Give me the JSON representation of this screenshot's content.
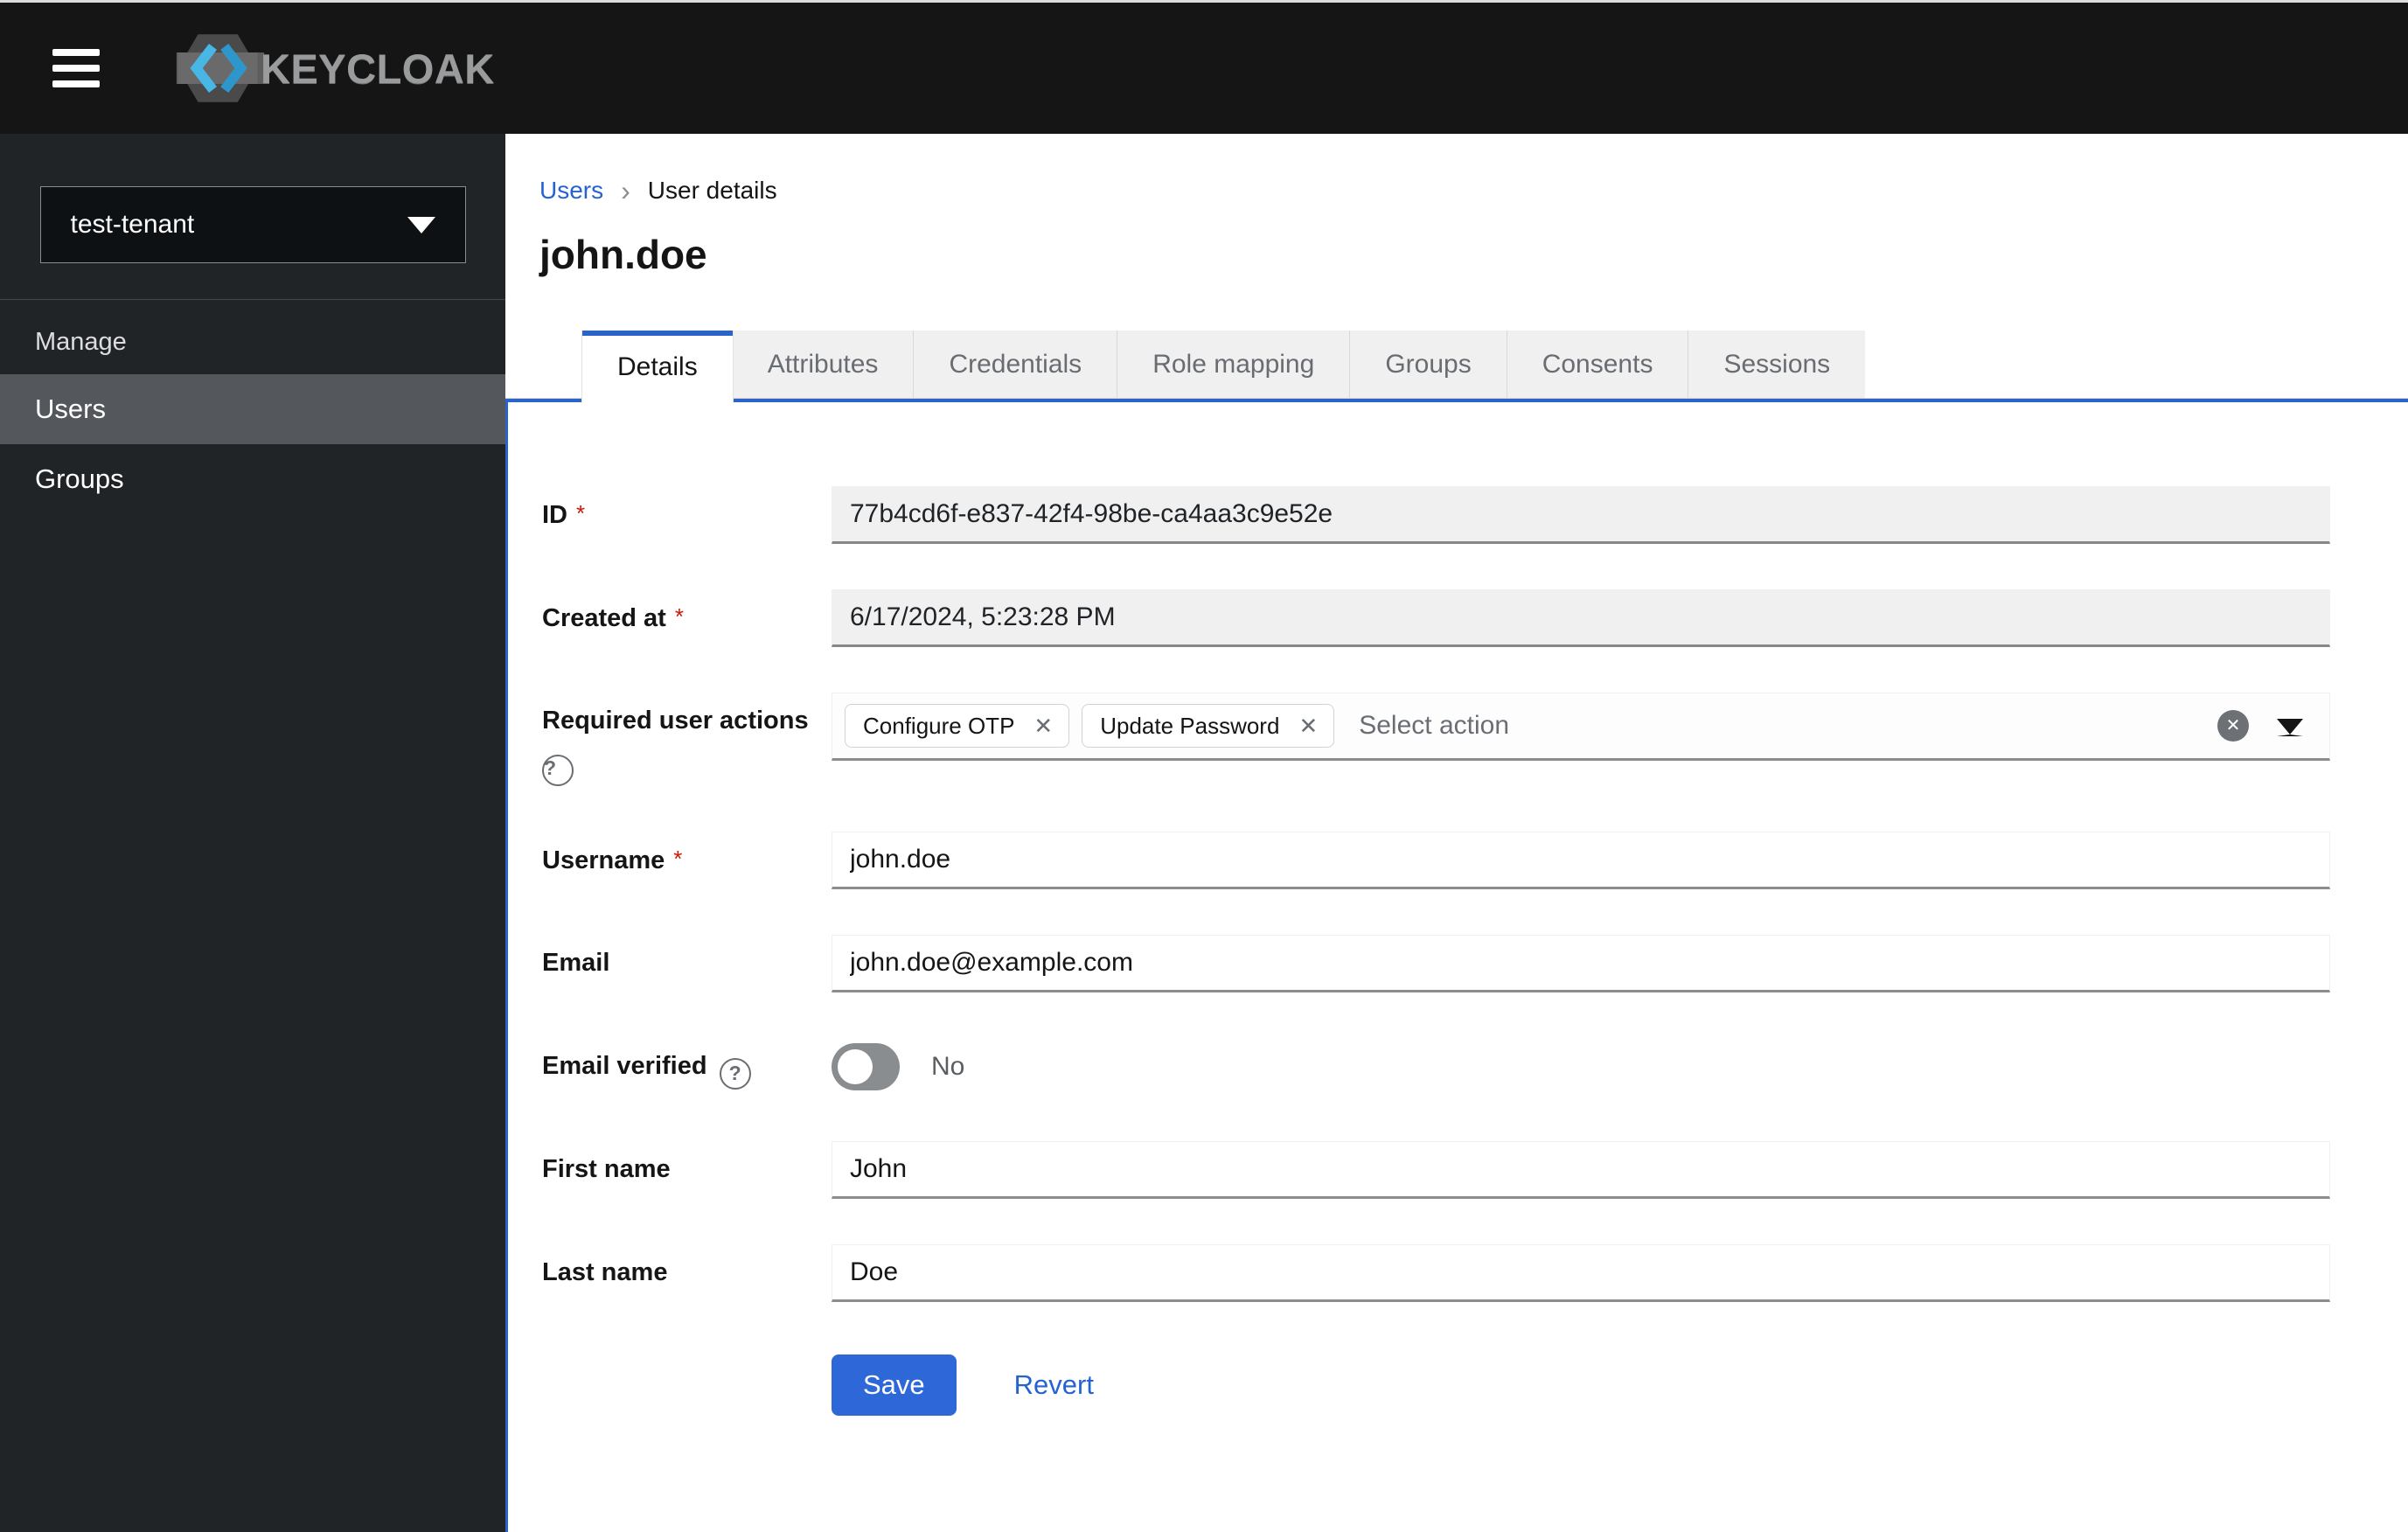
{
  "masthead": {
    "brand": "KEYCLOAK"
  },
  "sidebar": {
    "realm_selector": {
      "value": "test-tenant"
    },
    "section_label": "Manage",
    "items": [
      {
        "label": "Users",
        "selected": true
      },
      {
        "label": "Groups",
        "selected": false
      }
    ]
  },
  "breadcrumb": {
    "items": [
      {
        "label": "Users",
        "link": true
      },
      {
        "label": "User details",
        "link": false
      }
    ]
  },
  "page": {
    "title": "john.doe"
  },
  "tabs": [
    "Details",
    "Attributes",
    "Credentials",
    "Role mapping",
    "Groups",
    "Consents",
    "Sessions"
  ],
  "active_tab": "Details",
  "form": {
    "id": {
      "label": "ID",
      "required": true,
      "value": "77b4cd6f-e837-42f4-98be-ca4aa3c9e52e",
      "disabled": true
    },
    "created_at": {
      "label": "Created at",
      "required": true,
      "value": "6/17/2024, 5:23:28 PM",
      "disabled": true
    },
    "required_actions": {
      "label": "Required user actions",
      "chips": [
        "Configure OTP",
        "Update Password"
      ],
      "placeholder": "Select action"
    },
    "username": {
      "label": "Username",
      "required": true,
      "value": "john.doe"
    },
    "email": {
      "label": "Email",
      "value": "john.doe@example.com"
    },
    "email_verified": {
      "label": "Email verified",
      "value_label": "No",
      "enabled": false
    },
    "first_name": {
      "label": "First name",
      "value": "John"
    },
    "last_name": {
      "label": "Last name",
      "value": "Doe"
    },
    "actions": {
      "save": "Save",
      "revert": "Revert"
    }
  },
  "icons": {
    "breadcrumb_separator": "›",
    "chip_close": "✕",
    "clear": "✕",
    "help": "?"
  },
  "colors": {
    "accent_tab_border": "#2b64c8",
    "link_blue": "#2563d1",
    "save_button_blue": "#2e68d8",
    "danger_asterisk": "#c9190b",
    "masthead_bg": "#151515",
    "sidebar_bg": "#212427",
    "sidebar_selected_bg": "#54575b",
    "inactive_tab_bg": "#f0f0f0",
    "disabled_input_bg": "#f0f0f0",
    "input_bottom_border": "#8a8d90",
    "toggle_off_bg": "#8a8d90"
  }
}
